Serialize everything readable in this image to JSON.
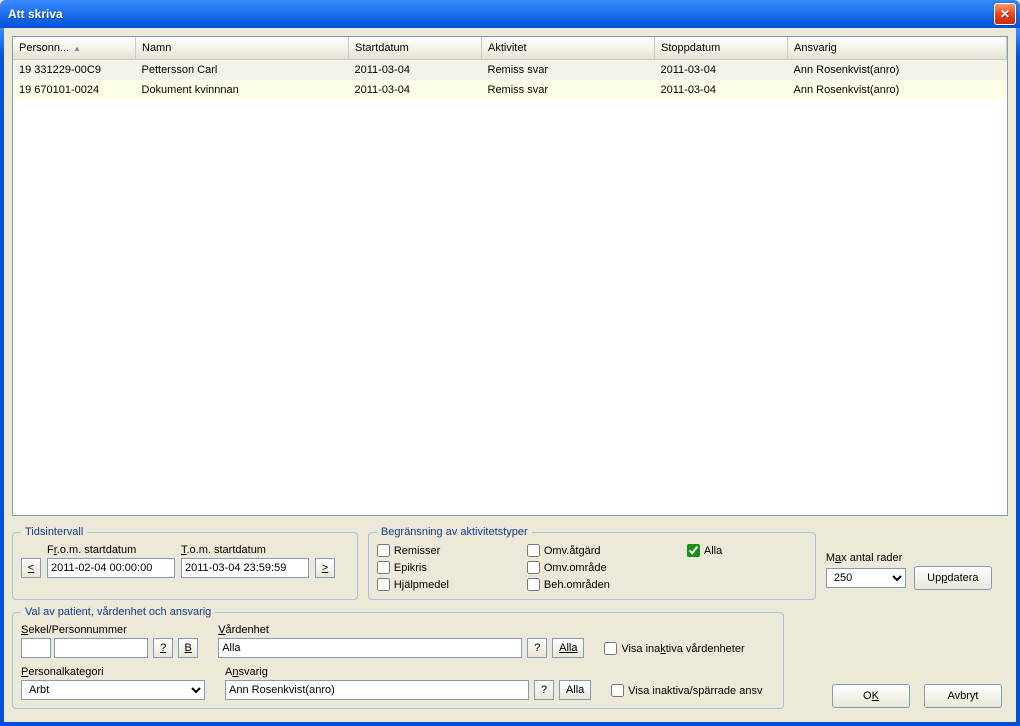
{
  "window": {
    "title": "Att skriva"
  },
  "icons": {
    "close": "✕",
    "sort_asc": "▲"
  },
  "grid": {
    "columns": [
      "Personn...",
      "Namn",
      "Startdatum",
      "Aktivitet",
      "Stoppdatum",
      "Ansvarig"
    ],
    "rows": [
      {
        "person": "19 331229-00C9",
        "namn": "Pettersson Carl",
        "start": "2011-03-04",
        "aktivitet": "Remiss svar",
        "stopp": "2011-03-04",
        "ansvarig": "Ann Rosenkvist(anro)"
      },
      {
        "person": "19 670101-0024",
        "namn": "Dokument kvinnnan",
        "start": "2011-03-04",
        "aktivitet": "Remiss svar",
        "stopp": "2011-03-04",
        "ansvarig": "Ann Rosenkvist(anro)"
      }
    ]
  },
  "tidsintervall": {
    "legend": "Tidsintervall",
    "from_label_pre": "F",
    "from_label_u": "r",
    "from_label_post": ".o.m. startdatum",
    "to_label_pre": "",
    "to_label_u": "T",
    "to_label_post": ".o.m. startdatum",
    "from_value": "2011-02-04 00:00:00",
    "to_value": "2011-03-04 23:59:59",
    "btn_lt": "<",
    "btn_gt": ">"
  },
  "begransning": {
    "legend": "Begränsning av aktivitetstyper",
    "remisser": "Remisser",
    "epikris": "Epikris",
    "hjalpmedel": "Hjälpmedel",
    "omv_atg": "Omv.åtgärd",
    "omv_omr": "Omv.område",
    "beh_omr": "Beh.områden",
    "alla": "Alla"
  },
  "maxrows": {
    "label_pre": "M",
    "label_u": "a",
    "label_post": "x antal rader",
    "value": "250",
    "update_pre": "Up",
    "update_u": "p",
    "update_post": "datera"
  },
  "val": {
    "legend": "Val av patient, vårdenhet och ansvarig",
    "sekel_label": "Sekel/Personnummer",
    "q": "?",
    "b": "B",
    "vardenhet_label": "Vårdenhet",
    "vardenhet_value": "Alla",
    "alla_btn": "Alla",
    "visa_inaktiva_label_pre": "Visa ina",
    "visa_inaktiva_label_u": "k",
    "visa_inaktiva_label_post": "tiva vårdenheter",
    "pk_label": "Personalkategori",
    "pk_value": "Arbt",
    "ansvarig_label": "Ansvarig",
    "ansvarig_value": "Ann Rosenkvist(anro)",
    "visa_sparr_label": "Visa inaktiva/spärrade ansv"
  },
  "buttons": {
    "ok_pre": "O",
    "ok_u": "K",
    "avbryt": "Avbryt"
  }
}
